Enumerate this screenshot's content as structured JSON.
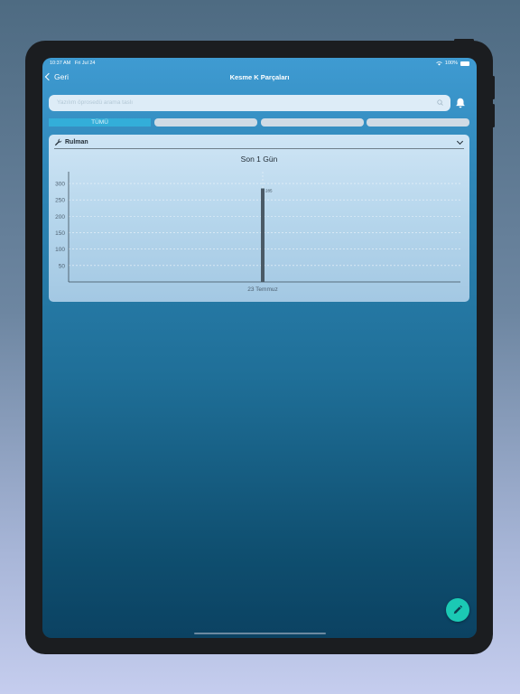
{
  "status_bar": {
    "time": "10:37 AM",
    "date": "Fri Jul 24",
    "battery": "100%"
  },
  "nav": {
    "back_label": "Geri",
    "title": "Kesme K Parçaları"
  },
  "search": {
    "placeholder": "Yazılım öprosedü arama taslı"
  },
  "tabs": [
    {
      "label": "TÜMÜ",
      "active": true
    },
    {
      "label": "",
      "active": false
    },
    {
      "label": "",
      "active": false
    },
    {
      "label": "",
      "active": false
    }
  ],
  "card": {
    "title": "Rulman"
  },
  "chart_data": {
    "type": "bar",
    "title": "Son 1 Gün",
    "categories": [
      "23 Temmuz"
    ],
    "values": [
      285
    ],
    "data_labels": [
      "285"
    ],
    "yticks": [
      50,
      100,
      150,
      200,
      250,
      300
    ],
    "ylim": [
      0,
      325
    ],
    "grid": true,
    "xlabel": "",
    "ylabel": ""
  },
  "colors": {
    "accent": "#33aed9",
    "fab": "#1bc9b4",
    "bar": "#4a5a66"
  },
  "icons": {
    "search": "search-icon",
    "bell": "bell-icon",
    "wrench": "wrench-icon",
    "fab": "pencil-icon"
  }
}
